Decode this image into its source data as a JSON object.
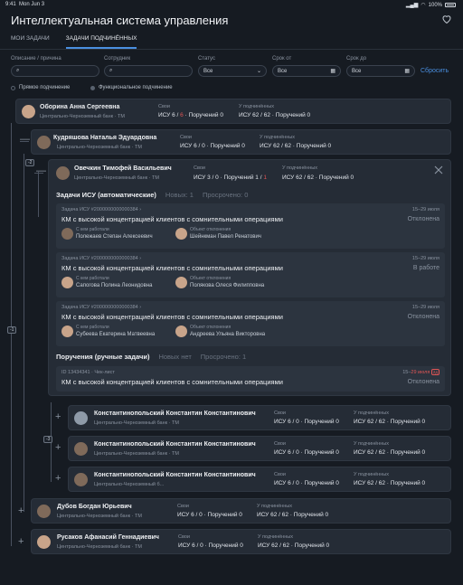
{
  "status_bar": {
    "time": "9:41",
    "date": "Mon Jun 3",
    "battery": "100%"
  },
  "app": {
    "title": "Интеллектуальная система управления"
  },
  "tabs": [
    {
      "label": "МОИ ЗАДАЧИ"
    },
    {
      "label": "ЗАДАЧИ ПОДЧИНЁННЫХ"
    }
  ],
  "filters": {
    "description_label": "Описание / причина",
    "employee_label": "Сотрудник",
    "status_label": "Статус",
    "status_value": "Все",
    "from_label": "Срок от",
    "from_value": "Все",
    "to_label": "Срок до",
    "to_value": "Все",
    "reset_label": "Сбросить"
  },
  "subordination": {
    "direct": "Прямое подчинение",
    "functional": "Функциональное подчинение"
  },
  "common": {
    "own": "Свои",
    "subordinates": "У подчинённых",
    "bank": "Центрально-Черноземный банк",
    "bank_short": "Центрально-Черноземный б...",
    "tm": "ТМ",
    "dot": "·",
    "isu_prefix": "ИСУ",
    "orders_prefix": "Поручений",
    "worked_with": "С кем работали",
    "rejection_object": "Объект отклонения"
  },
  "employees": [
    {
      "name": "Оборина Анна Сергеевна",
      "own_isu": "6 / ",
      "own_isu_red": "6",
      "own_orders": "0",
      "sub_isu": "62 / 62",
      "sub_orders": "0"
    },
    {
      "name": "Кудряшова Наталья Эдуардовна",
      "own_isu": "6 / 0",
      "own_orders": "0",
      "sub_isu": "62 / 62",
      "sub_orders": "0"
    },
    {
      "name": "Овечкин Тимофей Васильевич",
      "own_isu": "3 / 0",
      "own_orders": "1 / ",
      "own_orders_red": "1",
      "sub_isu": "62 / 62",
      "sub_orders": "0"
    },
    {
      "name": "Константинопольский Константин Константинович",
      "own_isu": "6 / 0",
      "own_orders": "0",
      "sub_isu": "62 / 62",
      "sub_orders": "0"
    },
    {
      "name": "Константинопольский Константин Константинович",
      "own_isu": "6 / 0",
      "own_orders": "0",
      "sub_isu": "62 / 62",
      "sub_orders": "0"
    },
    {
      "name": "Константинопольский Константин Константинович",
      "own_isu": "6 / 0",
      "own_orders": "0",
      "sub_isu": "62 / 62",
      "sub_orders": "0"
    },
    {
      "name": "Дубов Богдан Юрьевич",
      "own_isu": "6 / 0",
      "own_orders": "0",
      "sub_isu": "62 / 62",
      "sub_orders": "0"
    },
    {
      "name": "Русаков Афанасий Геннадиевич",
      "own_isu": "6 / 0",
      "own_orders": "0",
      "sub_isu": "62 / 62",
      "sub_orders": "0"
    }
  ],
  "badges": {
    "b2": "-2",
    "b1": "-1",
    "b3": "-3"
  },
  "isu_section": {
    "title": "Задачи ИСУ (автоматические)",
    "new": "Новых: 1",
    "overdue": "Просрочено: 0"
  },
  "isu_tasks": [
    {
      "id": "Задача ИСУ #2000000000000384",
      "date": "15–29 июля",
      "title": "КМ с высокой концентрацией клиентов с сомнительными операциями",
      "status": "Отклонена",
      "person1": "Полежаев Степан Алексеевич",
      "person2": "Шейнкман Павел Ренатович"
    },
    {
      "id": "Задача ИСУ #2000000000000384",
      "date": "15–29 июля",
      "title": "КМ с высокой концентрацией клиентов с сомнительными операциями",
      "status": "В работе",
      "person1": "Сапогова Полина Леонидовна",
      "person2": "Полякова Олеся Филипповна"
    },
    {
      "id": "Задача ИСУ #2000000000000384",
      "date": "15–29 июля",
      "title": "КМ с высокой концентрацией клиентов с сомнительными операциями",
      "status": "Отклонена",
      "person1": "Субеева Екатерина Матвеевна",
      "person2": "Андреева Ульяна Викторовна"
    }
  ],
  "orders_section": {
    "title": "Поручения (ручные задачи)",
    "new": "Новых нет",
    "overdue": "Просрочено: 1"
  },
  "order": {
    "id": "ID 13434341 · Чек-лист",
    "date_start": "15–",
    "date_red": "29 июля",
    "overdue_count": "2д",
    "title": "КМ с высокой концентрацией клиентов с сомнительными операциями",
    "status": "Отклонена"
  },
  "colors": {
    "accent": "#4a8fe0",
    "danger": "#e05555",
    "background": "#161b22",
    "card": "#252c36"
  }
}
